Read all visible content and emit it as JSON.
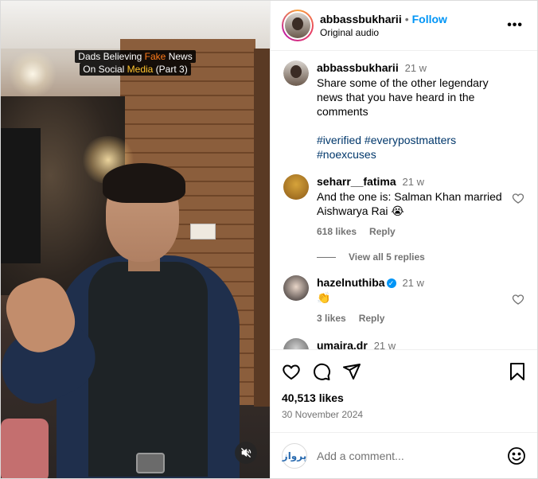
{
  "video": {
    "caption_line1_pre": "Dads Believing ",
    "caption_line1_accent": "Fake",
    "caption_line1_post": " News",
    "caption_line2_pre": "On Social ",
    "caption_line2_accent": "Media",
    "caption_line2_post": " (Part 3)",
    "mute_icon": "speaker-muted-icon"
  },
  "header": {
    "username": "abbassbukharii",
    "separator": "•",
    "follow_label": "Follow",
    "audio": "Original audio",
    "more": "•••"
  },
  "caption_comment": {
    "username": "abbassbukharii",
    "time": "21 w",
    "text": "Share some of the other legendary news that you have heard in the comments",
    "hashtags_line1": "#iverified #everypostmatters",
    "hashtags_line2": "#noexcuses"
  },
  "comments": [
    {
      "username": "seharr__fatima",
      "time": "21 w",
      "text": "And the one is: Salman Khan married Aishwarya Rai 😭",
      "likes": "618 likes",
      "reply": "Reply",
      "view_replies": "View all 5 replies"
    },
    {
      "username": "hazelnuthiba",
      "verified": true,
      "time": "21 w",
      "text": "👏",
      "likes": "3 likes",
      "reply": "Reply"
    },
    {
      "username": "umaira.dr",
      "time": "21 w",
      "text": "😂😂😂😂😂😂😂😂😂"
    }
  ],
  "actions": {
    "likes": "40,513 likes",
    "date": "30 November 2024"
  },
  "add_comment": {
    "placeholder": "Add a comment...",
    "avatar_text": "پرواز"
  },
  "colors": {
    "follow": "#0095f6",
    "hashtag": "#00376b",
    "secondary_text": "#737373",
    "caption_accent": "#ff7a1a"
  }
}
